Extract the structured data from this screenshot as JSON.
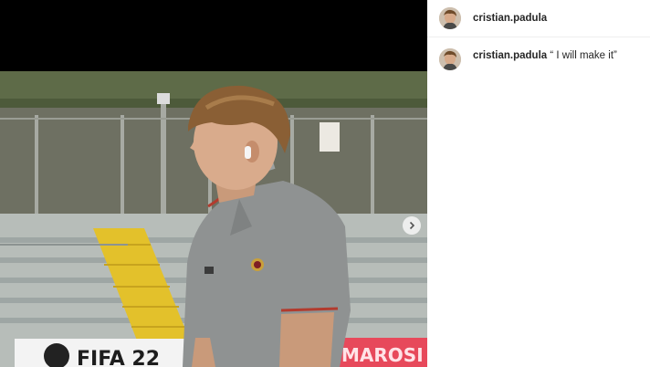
{
  "post": {
    "author": {
      "username": "cristian.padula",
      "avatar_icon": "profile-avatar"
    },
    "caption": {
      "username": "cristian.padula",
      "text": " “ I will make it”"
    },
    "media": {
      "next_icon": "chevron-right-icon",
      "banner_text_left": "FIFA 22",
      "banner_text_right": "MAROSI"
    }
  }
}
